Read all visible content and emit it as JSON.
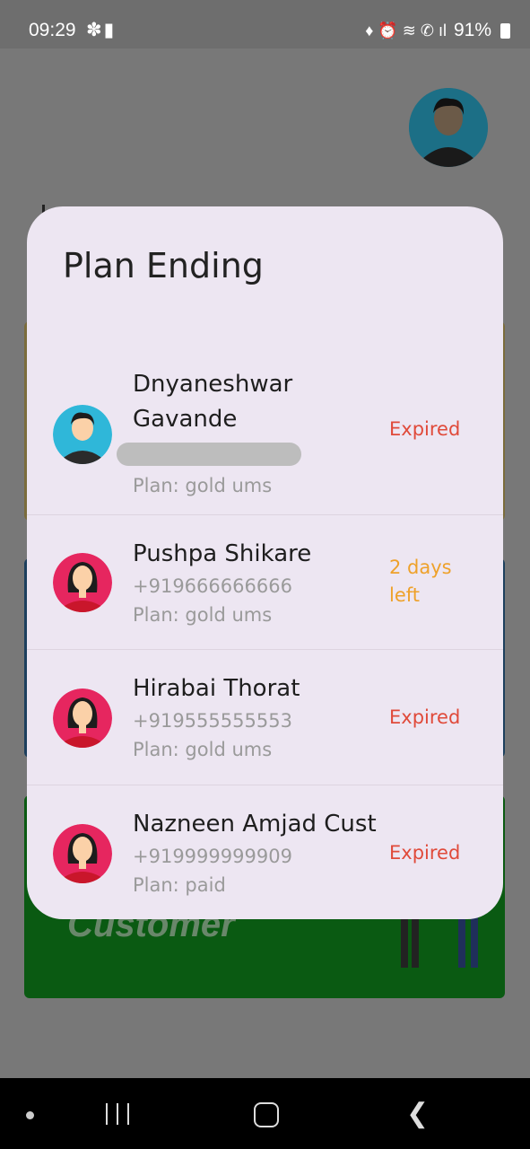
{
  "status_bar": {
    "time": "09:29",
    "left_icons": "✽▮",
    "right_icons": "♦ ⏰ ≋ ✆ ıl",
    "battery": "91%"
  },
  "background": {
    "card_title": "Customer"
  },
  "dialog": {
    "title": "Plan Ending",
    "items": [
      {
        "name": "Dnyaneshwar Gavande",
        "phone": "",
        "phone_redacted": true,
        "plan": "Plan: gold ums",
        "status": "Expired",
        "status_type": "expired",
        "avatar": "male-avatar-icon"
      },
      {
        "name": "Pushpa Shikare",
        "phone": "+919666666666",
        "plan": "Plan: gold ums",
        "status": "2 days left",
        "status_type": "warning",
        "avatar": "female-avatar-icon"
      },
      {
        "name": "Hirabai Thorat",
        "phone": "+919555555553",
        "plan": "Plan: gold ums",
        "status": "Expired",
        "status_type": "expired",
        "avatar": "female-avatar-icon"
      },
      {
        "name": "Nazneen Amjad Cust",
        "phone": "+919999999909",
        "plan": "Plan: paid",
        "status": "Expired",
        "status_type": "expired",
        "avatar": "female-avatar-icon"
      }
    ]
  },
  "colors": {
    "dialog_bg": "#ede6f2",
    "expired": "#e04a3a",
    "warning": "#eea12a"
  }
}
